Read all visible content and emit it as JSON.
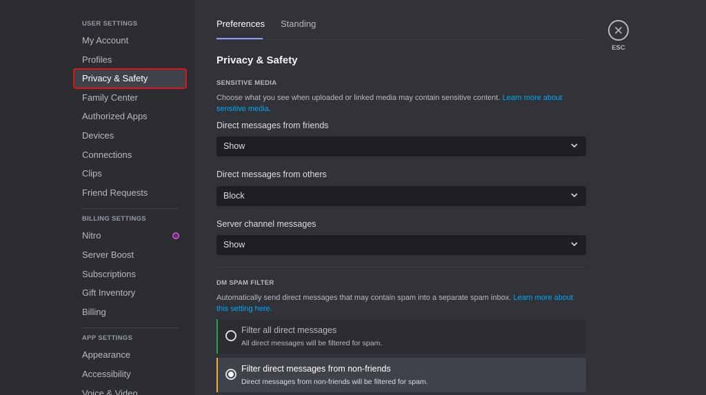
{
  "sidebar": {
    "user_settings_header": "USER SETTINGS",
    "user_items": [
      {
        "label": "My Account"
      },
      {
        "label": "Profiles"
      },
      {
        "label": "Privacy & Safety"
      },
      {
        "label": "Family Center"
      },
      {
        "label": "Authorized Apps"
      },
      {
        "label": "Devices"
      },
      {
        "label": "Connections"
      },
      {
        "label": "Clips"
      },
      {
        "label": "Friend Requests"
      }
    ],
    "billing_settings_header": "BILLING SETTINGS",
    "billing_items": [
      {
        "label": "Nitro"
      },
      {
        "label": "Server Boost"
      },
      {
        "label": "Subscriptions"
      },
      {
        "label": "Gift Inventory"
      },
      {
        "label": "Billing"
      }
    ],
    "app_settings_header": "APP SETTINGS",
    "app_items": [
      {
        "label": "Appearance"
      },
      {
        "label": "Accessibility"
      },
      {
        "label": "Voice & Video"
      }
    ]
  },
  "tabs": [
    {
      "label": "Preferences"
    },
    {
      "label": "Standing"
    }
  ],
  "page_title": "Privacy & Safety",
  "sensitive_media": {
    "header": "SENSITIVE MEDIA",
    "description": "Choose what you see when uploaded or linked media may contain sensitive content.",
    "link": "Learn more about sensitive media.",
    "fields": [
      {
        "label": "Direct messages from friends",
        "value": "Show"
      },
      {
        "label": "Direct messages from others",
        "value": "Block"
      },
      {
        "label": "Server channel messages",
        "value": "Show"
      }
    ]
  },
  "dm_spam_filter": {
    "header": "DM SPAM FILTER",
    "description": "Automatically send direct messages that may contain spam into a separate spam inbox.",
    "link": "Learn more about this setting here.",
    "options": [
      {
        "title": "Filter all direct messages",
        "desc": "All direct messages will be filtered for spam.",
        "selected": false,
        "accent": "#23a55a"
      },
      {
        "title": "Filter direct messages from non-friends",
        "desc": "Direct messages from non-friends will be filtered for spam.",
        "selected": true,
        "accent": "#f0b232"
      }
    ]
  },
  "close": {
    "label": "ESC"
  },
  "colors": {
    "accent": "#949cf7",
    "link": "#00a8fc",
    "highlight_box": "#e0141c",
    "nitro": "#d34ae3"
  }
}
